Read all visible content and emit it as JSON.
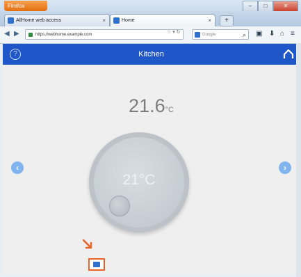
{
  "browser": {
    "menu_label": "Firefox",
    "tabs": [
      {
        "label": "AllHome web access"
      },
      {
        "label": "Home"
      }
    ],
    "new_tab": "+",
    "url": "https://webhome.example.com",
    "search_placeholder": "Google"
  },
  "app": {
    "title": "Kitchen",
    "current_temp": "21.6",
    "current_unit": "°C",
    "setpoint": "21°C"
  },
  "colors": {
    "header": "#1f56c8",
    "accent_arrow": "#7fb4ef",
    "highlight": "#e8642a"
  },
  "icons": {
    "help": "question-circle-icon",
    "home": "home-icon",
    "left": "chevron-left-icon",
    "right": "chevron-right-icon",
    "device": "device-icon"
  }
}
